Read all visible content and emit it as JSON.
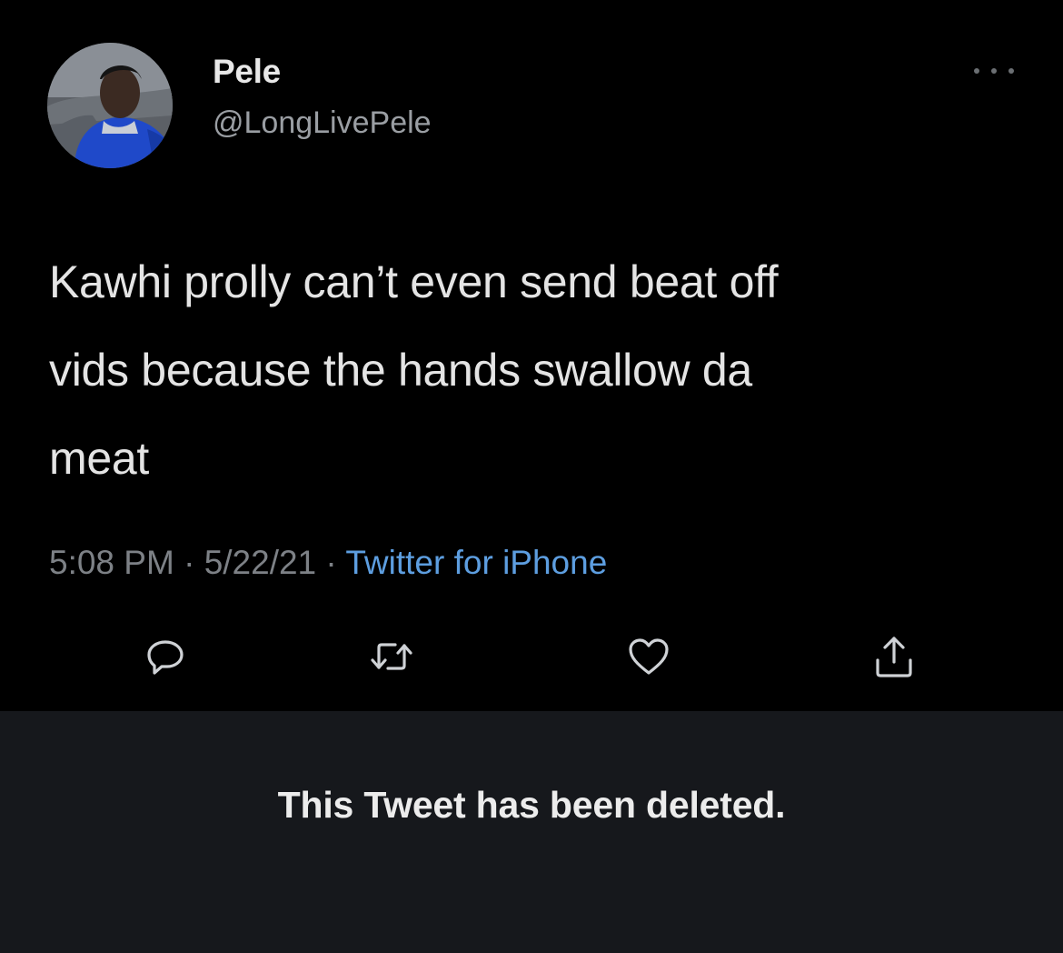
{
  "tweet": {
    "author": {
      "display_name": "Pele",
      "handle": "@LongLivePele",
      "avatar_icon": "user-avatar"
    },
    "more_icon": "more-horizontal-icon",
    "text_lines": [
      "Kawhi prolly can’t even send beat off",
      "vids because the hands swallow da",
      "meat"
    ],
    "meta": {
      "time": "5:08 PM",
      "date": "5/22/21",
      "separator": "·",
      "source": "Twitter for iPhone"
    },
    "actions": [
      {
        "name": "reply",
        "icon": "reply-icon"
      },
      {
        "name": "retweet",
        "icon": "retweet-icon"
      },
      {
        "name": "like",
        "icon": "heart-icon"
      },
      {
        "name": "share",
        "icon": "share-icon"
      }
    ]
  },
  "deleted_notice": {
    "text": "This Tweet has been deleted."
  },
  "colors": {
    "background": "#000000",
    "deleted_panel": "#16181c",
    "link_blue": "#5d9ee0",
    "muted_gray": "#7d8186"
  }
}
